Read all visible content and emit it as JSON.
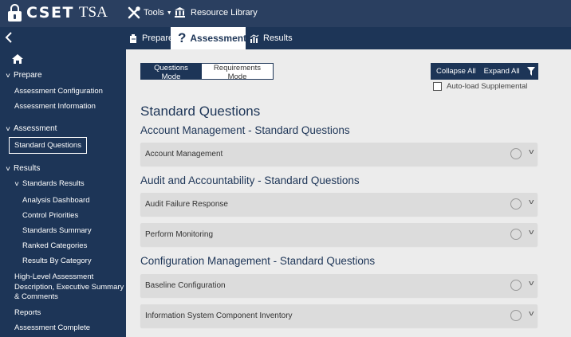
{
  "header": {
    "brand_name": "CSET",
    "brand_suffix": "TSA",
    "tools_label": "Tools",
    "resource_library_label": "Resource Library"
  },
  "tabs": {
    "prepare": "Prepare",
    "assessment": "Assessment",
    "results": "Results"
  },
  "sidebar": {
    "prepare": "Prepare",
    "assessment_configuration": "Assessment Configuration",
    "assessment_information": "Assessment Information",
    "assessment": "Assessment",
    "standard_questions": "Standard Questions",
    "results": "Results",
    "standards_results": "Standards Results",
    "analysis_dashboard": "Analysis Dashboard",
    "control_priorities": "Control Priorities",
    "standards_summary": "Standards Summary",
    "ranked_categories": "Ranked Categories",
    "results_by_category": "Results By Category",
    "high_level": "High-Level Assessment Description, Executive Summary & Comments",
    "reports": "Reports",
    "assessment_complete": "Assessment Complete"
  },
  "toolbar": {
    "questions_mode": "Questions Mode",
    "requirements_mode": "Requirements Mode",
    "collapse_all": "Collapse All",
    "expand_all": "Expand All",
    "autoload_supplemental": "Auto-load Supplemental"
  },
  "content": {
    "title": "Standard Questions",
    "groups": [
      {
        "heading": "Account Management - Standard Questions",
        "panels": [
          "Account Management"
        ]
      },
      {
        "heading": "Audit and Accountability - Standard Questions",
        "panels": [
          "Audit Failure Response",
          "Perform Monitoring"
        ]
      },
      {
        "heading": "Configuration Management - Standard Questions",
        "panels": [
          "Baseline Configuration",
          "Information System Component Inventory"
        ]
      }
    ]
  },
  "colors": {
    "header_bg": "#2a3f60",
    "nav_bg": "#1d3557",
    "content_bg": "#ececec",
    "panel_bg": "#dcdcdc"
  }
}
